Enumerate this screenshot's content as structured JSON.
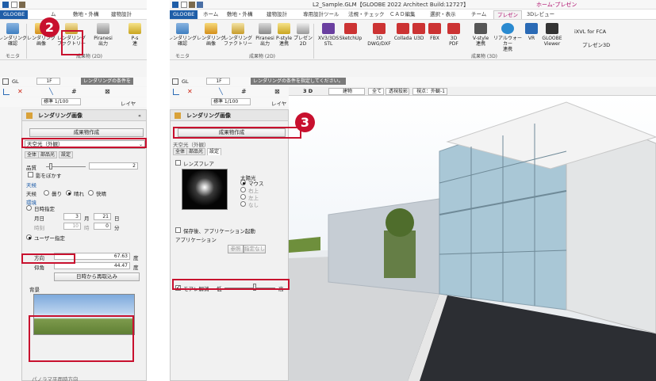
{
  "left": {
    "app_tab": "GLOOBE",
    "tabs": [
      "ム",
      "敷地・外構",
      "建物設計"
    ],
    "ribbon": {
      "buttons": [
        "レンダリング\n確認",
        "レンダリング\n画像",
        "レンダリング\nファクトリー",
        "Piranesi\n出力",
        "P-s\n連"
      ],
      "group_monitor": "モニタ",
      "group_output": "成果物 (2D)"
    },
    "toolbar": {
      "floor": "1F",
      "status": "レンダリングの条件を",
      "scale": "標準 1/100",
      "layer": "レイヤ"
    },
    "panel": {
      "title": "レンダリング画像",
      "create_button": "成果物作成",
      "preset": "天空光（外観）",
      "subtabs": [
        "全体",
        "部品光",
        "設定"
      ],
      "quality_label": "品質",
      "quality_value": "2",
      "blur_shadow": "影をぼかす",
      "weather_label": "天候",
      "weather_row_label": "天候",
      "weather_options": [
        "曇り",
        "晴れ",
        "快晴"
      ],
      "env_label": "環境",
      "datetime_label": "日時指定",
      "month_day_label": "月日",
      "month": "3",
      "month_unit": "月",
      "day": "21",
      "day_unit": "日",
      "time_label": "時刻",
      "hour": "10",
      "hour_unit": "時",
      "minute": "0",
      "minute_unit": "分",
      "user_spec": "ユーザー指定",
      "azimuth_label": "方向",
      "azimuth": "67.63",
      "elevation_label": "仰角",
      "elevation": "44.47",
      "deg": "度",
      "reload_button": "日時から再取込み",
      "background_label": "背景",
      "bottom_text": "パノラマ平面時方向"
    },
    "badge": "2"
  },
  "right": {
    "title": "L2_Sample.GLM【GLOOBE 2022 Architect Build:12727】",
    "title_right": "ホーム-プレゼン",
    "tabs": [
      "GLOOBE",
      "ホーム",
      "敷地・外構",
      "建物設計",
      "専用設計ツール",
      "法規・チェック",
      "ＣＡＤ編集",
      "選択・表示",
      "チーム",
      "プレゼン",
      "3Dレビュー"
    ],
    "ribbon": {
      "buttons": [
        "レンダリング\n確認",
        "レンダリング\n画像",
        "レンダリング\nファクトリー",
        "Piranesi\n出力",
        "P-style\n連携",
        "プレゼン\n2D",
        "XV3/3DS\nSTL",
        "SketchUp",
        "3D\nDWG/DXF",
        "Collada",
        "U3D",
        "FBX",
        "3D\nPDF",
        "V-style\n連携",
        "リアルウォーカー\n連携",
        "VR",
        "GLOOBE\nViewer"
      ],
      "xvl": "iXVL for FCA",
      "present3d": "プレゼン3D",
      "group_monitor": "モニタ",
      "group_2d": "成果物 (2D)",
      "group_3d": "成果物 (3D)"
    },
    "toolbar": {
      "floor": "1F",
      "status": "レンダリングの条件を指定してください。",
      "scale": "標準 1/100",
      "layer": "レイヤ",
      "view_mode": "3 D",
      "view_building": "建物",
      "view_all": "全て",
      "view_projection": "透視投影",
      "view_point": "視点：外観-1"
    },
    "panel": {
      "title": "レンダリング画像",
      "create_button": "成果物作成",
      "preset": "天空光（外観）",
      "subtabs": [
        "全体",
        "部品光",
        "設定"
      ],
      "lens_flare": "レンズフレア",
      "sun_label": "太陽光",
      "sun_options": [
        "マウス",
        "右上",
        "左上",
        "なし"
      ],
      "after_save": "保存後、アプリケーション起動",
      "app_label": "アプリケーション",
      "browse": "参照",
      "unspecified": "指定なし",
      "moire": "モアレ解消",
      "low": "低",
      "high": "高"
    },
    "badge": "3"
  },
  "colors": {
    "highlight": "#c8102e",
    "app_blue": "#1f5ea8",
    "accent_pink": "#b0106e"
  }
}
